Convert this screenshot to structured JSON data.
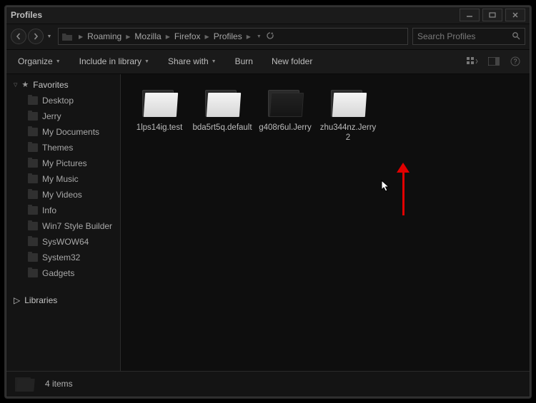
{
  "window": {
    "title": "Profiles"
  },
  "nav": {
    "breadcrumbs": [
      "Roaming",
      "Mozilla",
      "Firefox",
      "Profiles"
    ],
    "search_placeholder": "Search Profiles"
  },
  "toolbar": {
    "organize": "Organize",
    "include": "Include in library",
    "share": "Share with",
    "burn": "Burn",
    "newfolder": "New folder"
  },
  "sidebar": {
    "favorites_label": "Favorites",
    "items": [
      {
        "label": "Desktop"
      },
      {
        "label": "Jerry"
      },
      {
        "label": "My Documents"
      },
      {
        "label": "Themes"
      },
      {
        "label": "My Pictures"
      },
      {
        "label": "My Music"
      },
      {
        "label": "My Videos"
      },
      {
        "label": "Info"
      },
      {
        "label": "Win7 Style Builder"
      },
      {
        "label": "SysWOW64"
      },
      {
        "label": "System32"
      },
      {
        "label": "Gadgets"
      }
    ],
    "libraries_label": "Libraries"
  },
  "content": {
    "items": [
      {
        "label": "1lps14ig.test",
        "icon_style": "light"
      },
      {
        "label": "bda5rt5q.default",
        "icon_style": "light"
      },
      {
        "label": "g408r6ul.Jerry",
        "icon_style": "dark"
      },
      {
        "label": "zhu344nz.Jerry2",
        "icon_style": "light"
      }
    ]
  },
  "status": {
    "text": "4 items"
  },
  "annotation": {
    "note": "red-arrow-pointing-to-g408r6ul.Jerry"
  }
}
